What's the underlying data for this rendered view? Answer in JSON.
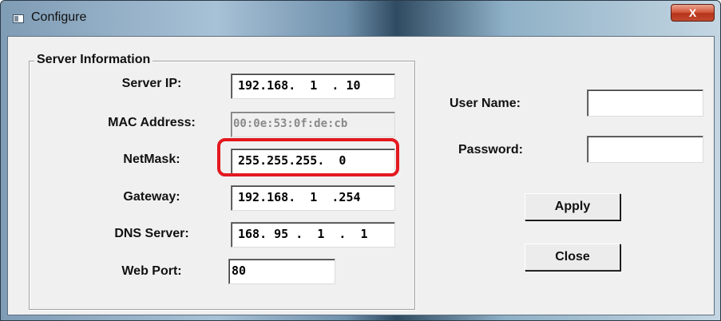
{
  "window": {
    "title": "Configure",
    "close_label": "X"
  },
  "server_info": {
    "group_title": "Server Information",
    "server_ip": {
      "label": "Server IP:",
      "value": "192.168.  1  . 10"
    },
    "mac_address": {
      "label": "MAC Address:",
      "value": "00:0e:53:0f:de:cb"
    },
    "netmask": {
      "label": "NetMask:",
      "value": "255.255.255.  0"
    },
    "gateway": {
      "label": "Gateway:",
      "value": "192.168.  1  .254"
    },
    "dns_server": {
      "label": "DNS Server:",
      "value": "168. 95 .  1  .  1"
    },
    "web_port": {
      "label": "Web Port:",
      "value": "80"
    }
  },
  "auth": {
    "username_label": "User Name:",
    "username_value": "",
    "password_label": "Password:",
    "password_value": ""
  },
  "buttons": {
    "apply": "Apply",
    "close": "Close"
  },
  "colors": {
    "highlight": "#e4181f",
    "dialog_bg": "#f0f0f0"
  }
}
